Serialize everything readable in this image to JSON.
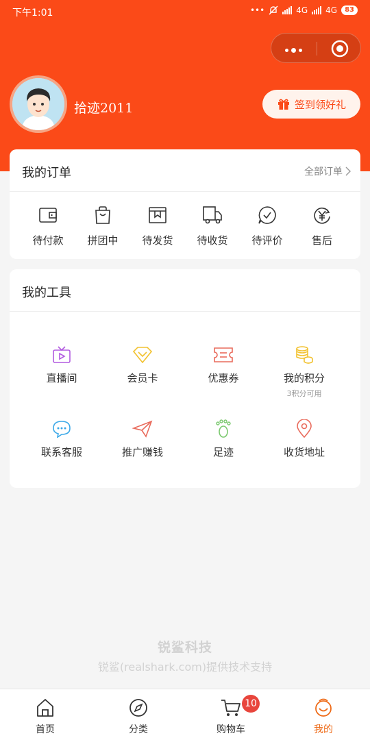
{
  "status_bar": {
    "time": "下午1:01",
    "net1": "4G",
    "net2": "4G",
    "battery": "83"
  },
  "profile": {
    "username": "拾迹2011",
    "signin_label": "签到领好礼"
  },
  "orders": {
    "title": "我的订单",
    "all_label": "全部订单",
    "items": [
      {
        "label": "待付款",
        "icon": "wallet-icon"
      },
      {
        "label": "拼团中",
        "icon": "bag-icon"
      },
      {
        "label": "待发货",
        "icon": "box-icon"
      },
      {
        "label": "待收货",
        "icon": "truck-icon"
      },
      {
        "label": "待评价",
        "icon": "comment-icon"
      },
      {
        "label": "售后",
        "icon": "yen-refresh-icon"
      }
    ]
  },
  "tools": {
    "title": "我的工具",
    "items": [
      {
        "label": "直播间",
        "icon": "tv-icon",
        "color": "#b25be0"
      },
      {
        "label": "会员卡",
        "icon": "diamond-icon",
        "color": "#f2c230"
      },
      {
        "label": "优惠券",
        "icon": "coupon-icon",
        "color": "#e96b5c"
      },
      {
        "label": "我的积分",
        "sub": "3积分可用",
        "icon": "coins-icon",
        "color": "#f2c230"
      },
      {
        "label": "联系客服",
        "icon": "chat-bubble-icon",
        "color": "#3aa8e8"
      },
      {
        "label": "推广赚钱",
        "icon": "paper-plane-icon",
        "color": "#e96b5c"
      },
      {
        "label": "足迹",
        "icon": "footprint-icon",
        "color": "#7bc96f"
      },
      {
        "label": "收货地址",
        "icon": "location-pin-icon",
        "color": "#e96b5c"
      }
    ]
  },
  "footer": {
    "brand": "锐鲨科技",
    "support": "锐鲨(realshark.com)提供技术支持"
  },
  "tabbar": {
    "items": [
      {
        "label": "首页",
        "icon": "home-icon"
      },
      {
        "label": "分类",
        "icon": "compass-icon"
      },
      {
        "label": "购物车",
        "icon": "cart-icon",
        "badge": "10"
      },
      {
        "label": "我的",
        "icon": "smiley-icon"
      }
    ]
  },
  "colors": {
    "brand": "#fb4a18",
    "active_tab": "#ee6a17",
    "badge": "#e8453c"
  }
}
